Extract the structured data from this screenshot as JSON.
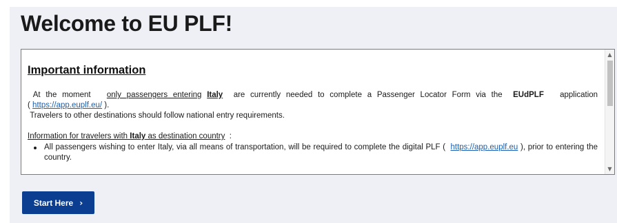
{
  "page": {
    "title": "Welcome to EU PLF!"
  },
  "info": {
    "heading": "Important information",
    "p1": {
      "t1": "At the moment",
      "t2": "only passengers entering",
      "t3": "Italy",
      "t4": "are currently needed to complete a Passenger Locator Form via the",
      "t5": "EUdPLF",
      "t6": "application",
      "t7": "(",
      "link": "https://app.euplf.eu/",
      "t8": ")."
    },
    "p2": "Travelers to other destinations should follow national entry requirements.",
    "p3": {
      "t1": "Information for travelers with",
      "t2": "Italy",
      "t3": "as destination country",
      "t4": ":"
    },
    "bullet1": {
      "t1": "All passengers wishing to enter Italy, via all means of transportation, will be required to complete the digital PLF (",
      "link": "https://app.euplf.eu",
      "t2": "), prior to entering the country."
    }
  },
  "scrollbar": {
    "up_icon": "scroll-up-arrow",
    "down_icon": "scroll-down-arrow"
  },
  "start_button": {
    "label": "Start Here",
    "icon": "chevron-right-icon",
    "chevron": "›",
    "color": "#0b3d91"
  },
  "colors": {
    "link": "#1a5fb4",
    "background": "#eef0f5"
  }
}
